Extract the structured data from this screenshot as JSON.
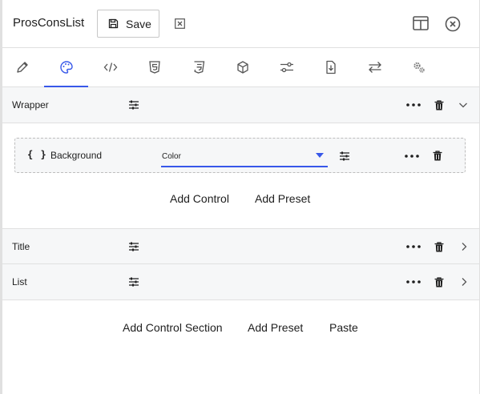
{
  "header": {
    "title": "ProsConsList",
    "save_label": "Save"
  },
  "toolbar": {
    "tools": [
      "pencil-icon",
      "palette-icon",
      "code-icon",
      "html5-icon",
      "css3-icon",
      "cube-icon",
      "slider-settings-icon",
      "download-file-icon",
      "swap-arrows-icon",
      "gears-icon"
    ],
    "active_tool": "palette-icon"
  },
  "sections": {
    "wrapper": {
      "label": "Wrapper",
      "state": "expanded"
    },
    "title": {
      "label": "Title",
      "state": "collapsed"
    },
    "list": {
      "label": "List",
      "state": "collapsed"
    }
  },
  "control": {
    "braces": "{ }",
    "label": "Background",
    "select_value": "Color"
  },
  "wrapper_actions": {
    "add_control": "Add Control",
    "add_preset": "Add Preset"
  },
  "footer_actions": {
    "add_control_section": "Add Control Section",
    "add_preset": "Add Preset",
    "paste": "Paste"
  },
  "colors": {
    "accent": "#3858e9",
    "section_bg": "#f6f7f8",
    "border": "#e0e0e0",
    "icon": "#555555"
  }
}
